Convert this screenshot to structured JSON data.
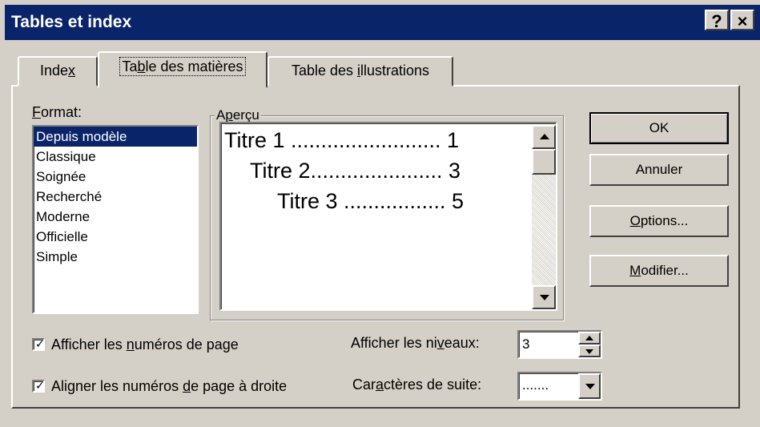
{
  "window": {
    "title": "Tables et index",
    "help_label": "?",
    "close_label": "×"
  },
  "tabs": [
    {
      "pre": "Inde",
      "u": "x",
      "post": ""
    },
    {
      "pre": "Ta",
      "u": "b",
      "post": "le des matières"
    },
    {
      "pre": "Table des ",
      "u": "i",
      "post": "llustrations"
    }
  ],
  "format": {
    "label_u": "F",
    "label_rest": "ormat:",
    "items": [
      "Depuis modèle",
      "Classique",
      "Soignée",
      "Recherché",
      "Moderne",
      "Officielle",
      "Simple"
    ],
    "selected": "Depuis modèle"
  },
  "preview": {
    "legend_pre": "A",
    "legend_u": "p",
    "legend_post": "erçu",
    "lines": [
      "Titre 1 ......................... 1",
      "Titre 2...................... 3",
      "Titre 3 ................. 5"
    ]
  },
  "buttons": {
    "ok": "OK",
    "cancel": "Annuler",
    "options_u": "O",
    "options_rest": "ptions...",
    "modify_u": "M",
    "modify_rest": "odifier..."
  },
  "checks": {
    "show_numbers": {
      "pre": "Afficher les ",
      "u": "n",
      "post": "uméros de page",
      "checked": true
    },
    "align_numbers": {
      "pre": "Aligner les numéros ",
      "u": "d",
      "post": "e page à droite",
      "checked": true
    }
  },
  "levels": {
    "pre": "Afficher les ni",
    "u": "v",
    "post": "eaux:",
    "value": "3"
  },
  "leader": {
    "pre": "Car",
    "u": "a",
    "post": "ctères de suite:",
    "value": "......."
  }
}
